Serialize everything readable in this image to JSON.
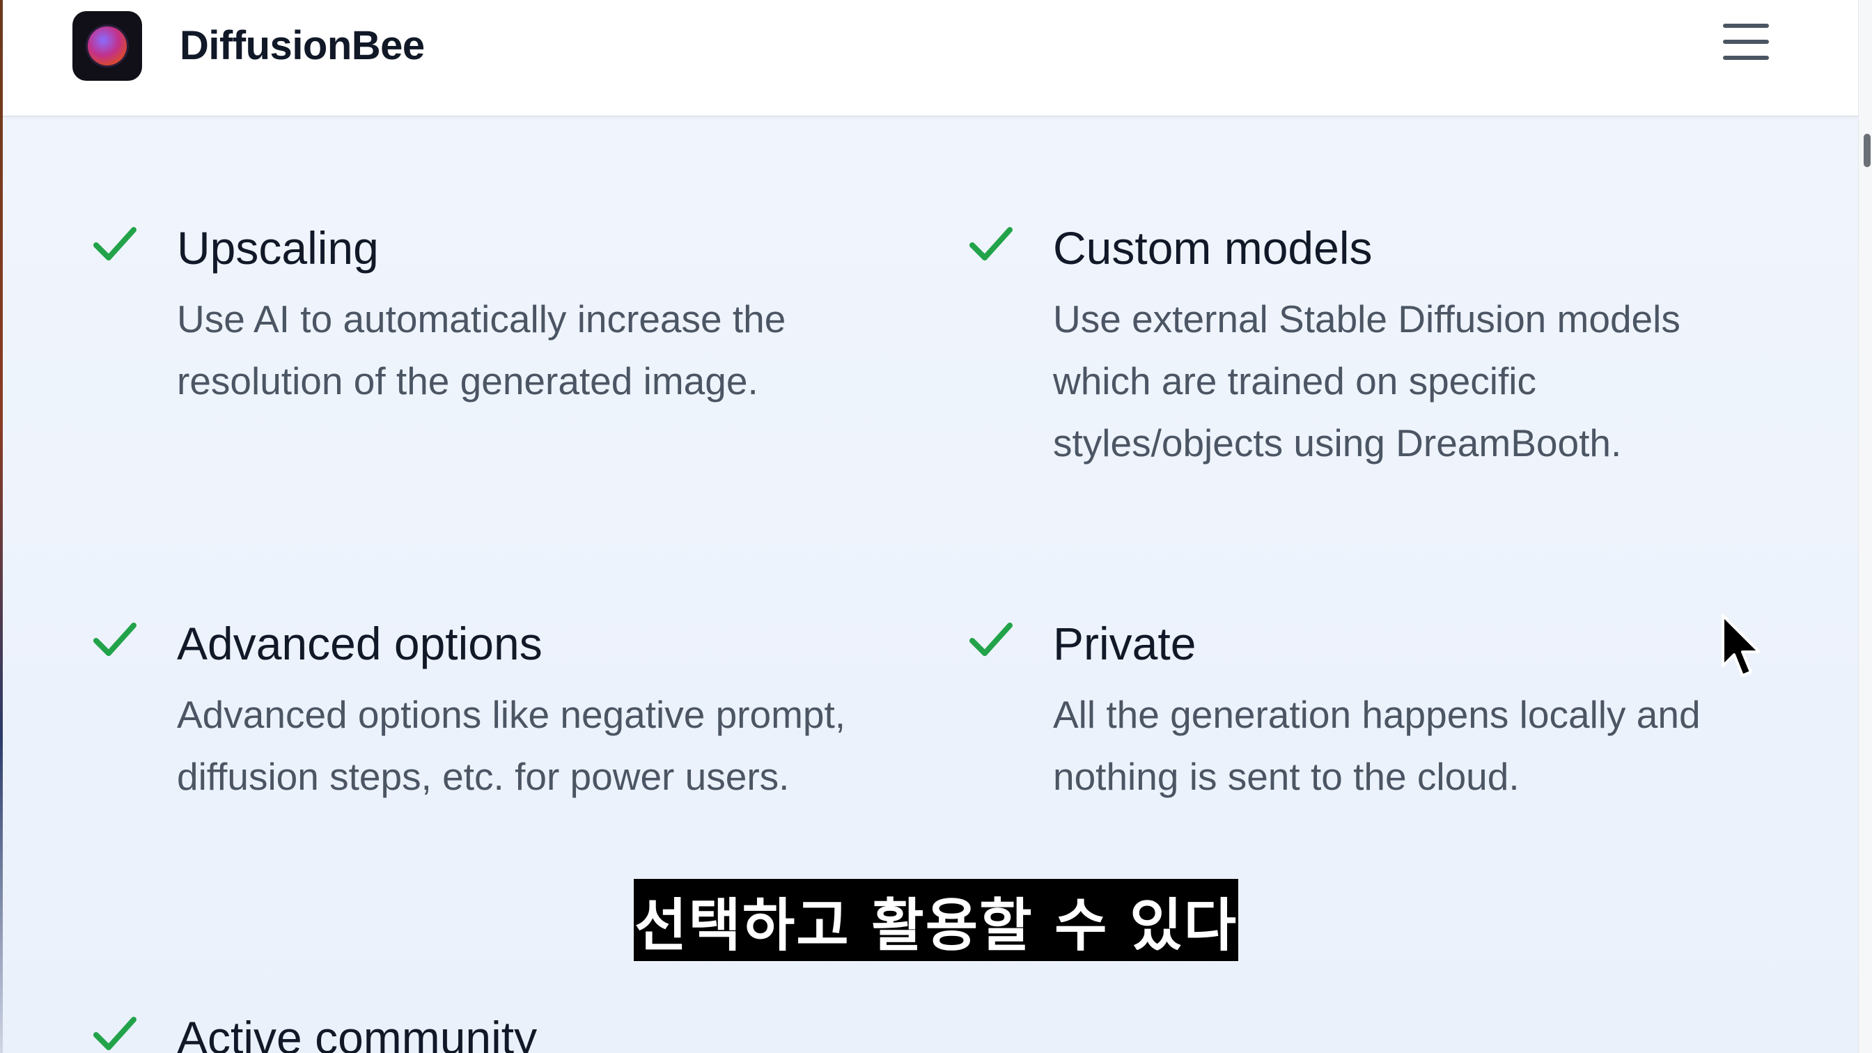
{
  "navbar": {
    "brand": "DiffusionBee",
    "logo": "diffusionbee-logo",
    "menu_icon": "hamburger-menu-icon"
  },
  "features": [
    {
      "title": "Upscaling",
      "description": "Use AI to automatically increase the resolution of the generated image."
    },
    {
      "title": "Custom models",
      "description": "Use external Stable Diffusion models which are trained on specific styles/objects using DreamBooth."
    },
    {
      "title": "Advanced options",
      "description": "Advanced options like negative prompt, diffusion steps, etc. for power users."
    },
    {
      "title": "Private",
      "description": "All the generation happens locally and nothing is sent to the cloud."
    },
    {
      "title": "Active community",
      "description": ""
    }
  ],
  "caption": {
    "text": "선택하고 활용할 수 있다"
  },
  "colors": {
    "check": "#22a34a",
    "title": "#111827",
    "body": "#4b5563",
    "background": "#eef3fb"
  }
}
